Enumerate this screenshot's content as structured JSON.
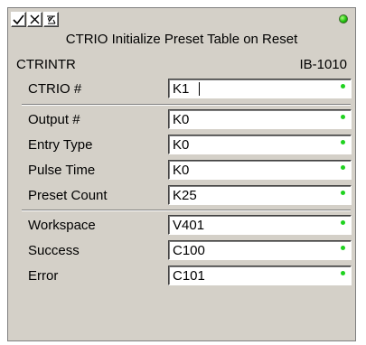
{
  "window": {
    "title": "CTRIO Initialize Preset Table on Reset",
    "instruction_name": "CTRINTR",
    "instruction_code": "IB-1010"
  },
  "toolbar": {
    "buttons": [
      {
        "icon": "check-icon"
      },
      {
        "icon": "cancel-icon"
      },
      {
        "icon": "help-icon"
      }
    ],
    "status_led_color": "#22c20f"
  },
  "fields": [
    {
      "label": "CTRIO #",
      "value": "K1"
    },
    {
      "label": "Output #",
      "value": "K0"
    },
    {
      "label": "Entry Type",
      "value": "K0"
    },
    {
      "label": "Pulse Time",
      "value": "K0"
    },
    {
      "label": "Preset Count",
      "value": "K25"
    },
    {
      "label": "Workspace",
      "value": "V401"
    },
    {
      "label": "Success",
      "value": "C100"
    },
    {
      "label": "Error",
      "value": "C101"
    }
  ],
  "colors": {
    "panel_bg": "#d4d0c8",
    "field_dot": "#1fd21f"
  }
}
